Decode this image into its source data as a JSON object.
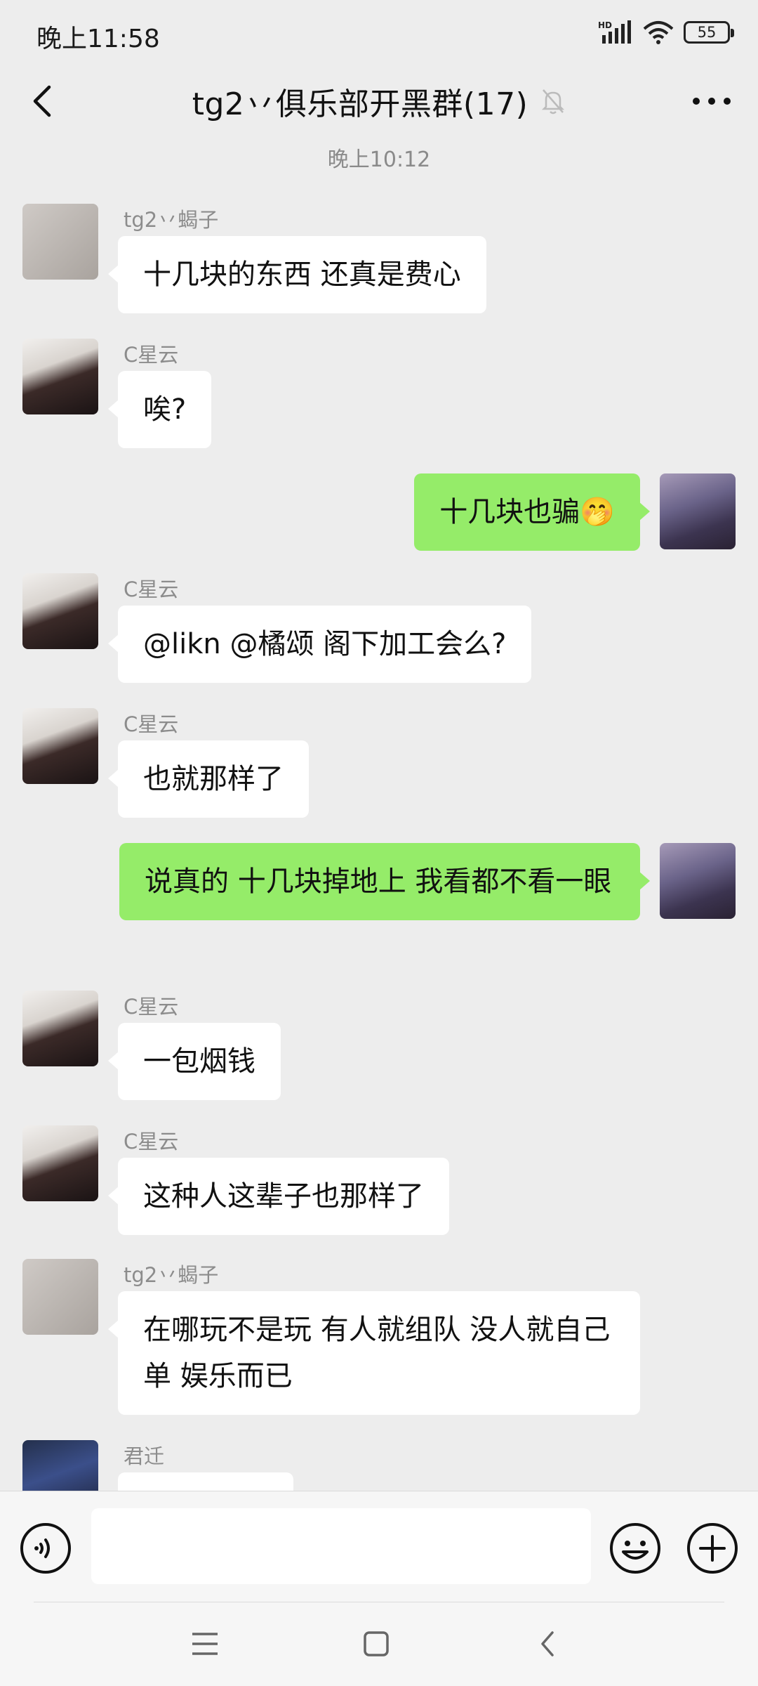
{
  "status_bar": {
    "time": "晚上11:58",
    "network": "HD",
    "battery": "55"
  },
  "header": {
    "title": "tg2丷俱乐部开黑群(17)"
  },
  "chat": {
    "timestamp": "晚上10:12",
    "messages": [
      {
        "sender": "tg2丷蝎子",
        "text": "十几块的东西   还真是费心"
      },
      {
        "sender": "C星云",
        "text": "唉?"
      },
      {
        "sender": "",
        "text": "十几块也骗🤭"
      },
      {
        "sender": "C星云",
        "text": "@likn @橘颂  阁下加工会么?"
      },
      {
        "sender": "C星云",
        "text": "也就那样了"
      },
      {
        "sender": "",
        "text": "说真的 十几块掉地上  我看都不看一眼"
      },
      {
        "sender": "C星云",
        "text": "一包烟钱"
      },
      {
        "sender": "C星云",
        "text": "这种人这辈子也那样了"
      },
      {
        "sender": "tg2丷蝎子",
        "text": "在哪玩不是玩  有人就组队  没人就自己单   娱乐而已"
      },
      {
        "sender": "君迁",
        "text": ""
      }
    ]
  },
  "input": {
    "placeholder": ""
  }
}
